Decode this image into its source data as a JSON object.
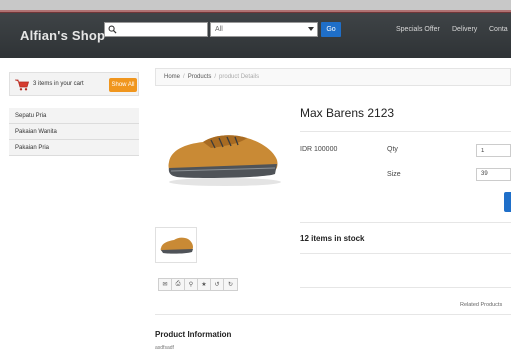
{
  "header": {
    "brand": "Alfian's Shop",
    "search_placeholder": "",
    "category_selected": "All",
    "go_label": "Go",
    "nav": [
      "Specials Offer",
      "Delivery",
      "Conta"
    ]
  },
  "cart": {
    "text": "3 items in your cart",
    "show_all_label": "Show All"
  },
  "sidebar": {
    "categories": [
      "Sepatu Pria",
      "Pakaian Wanita",
      "Pakaian Pria"
    ]
  },
  "breadcrumb": {
    "home": "Home",
    "products": "Products",
    "current": "product Details"
  },
  "product": {
    "title": "Max Barens 2123",
    "price": "IDR 100000",
    "qty_label": "Qty",
    "qty_value": "1",
    "size_label": "Size",
    "size_value": "39",
    "stock": "12 items in stock",
    "related_label": "Related Products",
    "info_title": "Product Information",
    "info_text": "asdfsadf"
  },
  "icons": {
    "toolbar": [
      "email-icon",
      "print-icon",
      "zoom-icon",
      "favorite-icon",
      "share-icon",
      "forward-icon"
    ]
  },
  "colors": {
    "header_bg": "#34383b",
    "go_button": "#1f6fc9",
    "show_all_button": "#f0961e"
  }
}
